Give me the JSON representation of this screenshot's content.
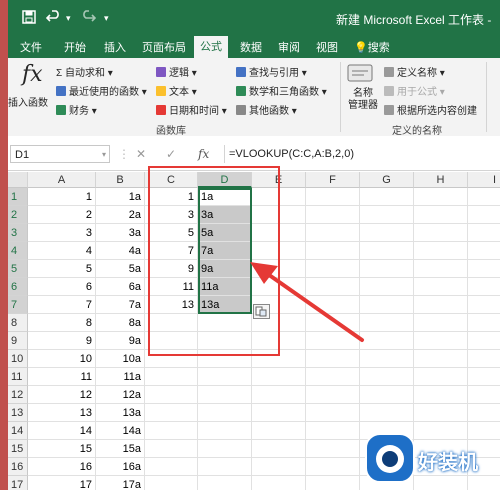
{
  "quick_access": {
    "save_icon": "save-icon",
    "undo_icon": "undo-icon",
    "redo_icon": "redo-icon"
  },
  "window_title": "新建 Microsoft Excel 工作表 -",
  "tabs": [
    "文件",
    "开始",
    "插入",
    "页面布局",
    "公式",
    "数据",
    "审阅",
    "视图",
    "搜索"
  ],
  "active_tab": "公式",
  "ribbon": {
    "insert_function": "插入函数",
    "insert_function_symbol": "fx",
    "autosum": "自动求和",
    "recent": "最近使用的函数",
    "financial": "财务",
    "logical": "逻辑",
    "text": "文本",
    "datetime": "日期和时间",
    "lookup": "查找与引用",
    "math": "数学和三角函数",
    "other": "其他函数",
    "name_manager_1": "名称",
    "name_manager_2": "管理器",
    "define_name": "定义名称",
    "use_in_formula": "用于公式",
    "create_from_selection": "根据所选内容创建",
    "group_library": "函数库",
    "group_names": "定义的名称"
  },
  "formula_bar": {
    "name_box": "D1",
    "formula": "=VLOOKUP(C:C,A:B,2,0)",
    "fx_label": "fx"
  },
  "columns": [
    "A",
    "B",
    "C",
    "D",
    "E",
    "F",
    "G",
    "H",
    "I"
  ],
  "rows": [
    {
      "n": "1",
      "a": "1",
      "b": "1a",
      "c": "1",
      "d": "1a"
    },
    {
      "n": "2",
      "a": "2",
      "b": "2a",
      "c": "3",
      "d": "3a"
    },
    {
      "n": "3",
      "a": "3",
      "b": "3a",
      "c": "5",
      "d": "5a"
    },
    {
      "n": "4",
      "a": "4",
      "b": "4a",
      "c": "7",
      "d": "7a"
    },
    {
      "n": "5",
      "a": "5",
      "b": "5a",
      "c": "9",
      "d": "9a"
    },
    {
      "n": "6",
      "a": "6",
      "b": "6a",
      "c": "11",
      "d": "11a"
    },
    {
      "n": "7",
      "a": "7",
      "b": "7a",
      "c": "13",
      "d": "13a"
    },
    {
      "n": "8",
      "a": "8",
      "b": "8a",
      "c": "",
      "d": ""
    },
    {
      "n": "9",
      "a": "9",
      "b": "9a",
      "c": "",
      "d": ""
    },
    {
      "n": "10",
      "a": "10",
      "b": "10a",
      "c": "",
      "d": ""
    },
    {
      "n": "11",
      "a": "11",
      "b": "11a",
      "c": "",
      "d": ""
    },
    {
      "n": "12",
      "a": "12",
      "b": "12a",
      "c": "",
      "d": ""
    },
    {
      "n": "13",
      "a": "13",
      "b": "13a",
      "c": "",
      "d": ""
    },
    {
      "n": "14",
      "a": "14",
      "b": "14a",
      "c": "",
      "d": ""
    },
    {
      "n": "15",
      "a": "15",
      "b": "15a",
      "c": "",
      "d": ""
    },
    {
      "n": "16",
      "a": "16",
      "b": "16a",
      "c": "",
      "d": ""
    },
    {
      "n": "17",
      "a": "17",
      "b": "17a",
      "c": "",
      "d": ""
    }
  ],
  "watermark": "好装机",
  "colors": {
    "excel_green": "#217346",
    "annotation_red": "#e53935"
  }
}
